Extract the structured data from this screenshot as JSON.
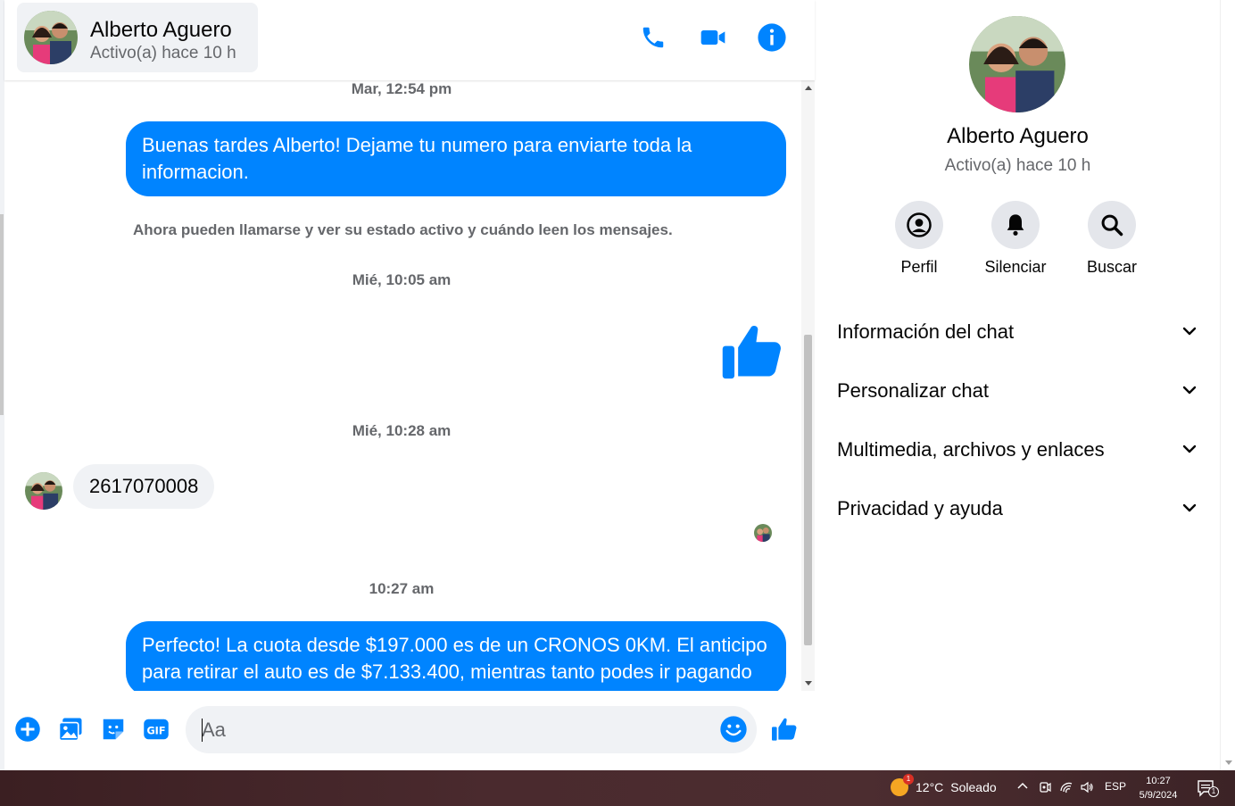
{
  "header": {
    "contact_name": "Alberto Aguero",
    "contact_status": "Activo(a) hace 10 h",
    "icons": [
      "phone-icon",
      "video-camera-icon",
      "info-icon"
    ]
  },
  "messages": {
    "timestamp_1": "Mar, 12:54 pm",
    "outgoing_1": "Buenas tardes Alberto! Dejame tu numero para enviarte toda la informacion.",
    "system_note": "Ahora pueden llamarse y ver su estado activo y cuándo leen los mensajes.",
    "timestamp_2": "Mié, 10:05 am",
    "timestamp_3": "Mié, 10:28 am",
    "incoming_1": "2617070008",
    "timestamp_4": "10:27 am",
    "outgoing_2": "Perfecto! La cuota desde $197.000 es de un CRONOS 0KM. El anticipo para retirar el auto es de $7.133.400, mientras tanto podes ir pagando"
  },
  "composer": {
    "placeholder": "Aa",
    "icons": [
      "plus-icon",
      "image-icon",
      "sticker-icon",
      "gif-icon",
      "emoji-icon",
      "thumbs-up-icon"
    ]
  },
  "info_panel": {
    "name": "Alberto Aguero",
    "status": "Activo(a) hace 10 h",
    "actions": [
      {
        "label": "Perfil",
        "icon": "profile-icon"
      },
      {
        "label": "Silenciar",
        "icon": "bell-icon"
      },
      {
        "label": "Buscar",
        "icon": "search-icon"
      }
    ],
    "sections": [
      {
        "title": "Información del chat"
      },
      {
        "title": "Personalizar chat"
      },
      {
        "title": "Multimedia, archivos y enlaces"
      },
      {
        "title": "Privacidad y ayuda"
      }
    ]
  },
  "taskbar": {
    "weather_temp": "12°C",
    "weather_desc": "Soleado",
    "weather_badge": "1",
    "language": "ESP",
    "time": "10:27",
    "date": "5/9/2024",
    "notification_count": "1"
  },
  "colors": {
    "accent": "#0084ff",
    "bubble_in": "#f0f2f5",
    "secondary_text": "#65676b"
  }
}
